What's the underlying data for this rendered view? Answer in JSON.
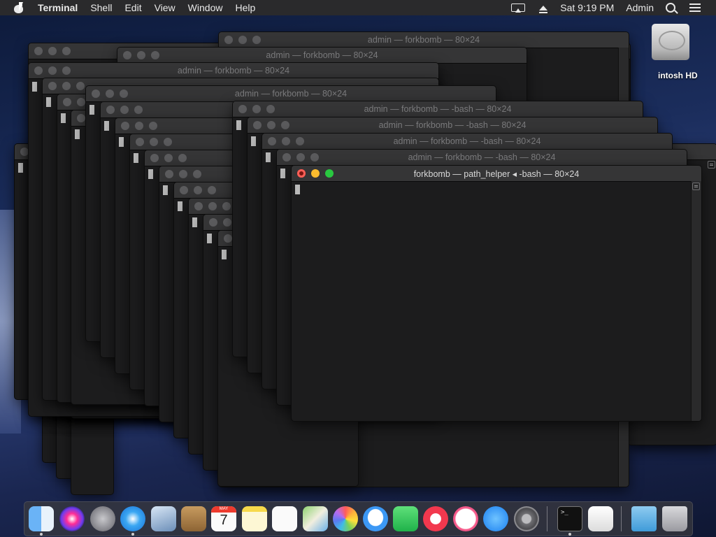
{
  "menubar": {
    "app_name": "Terminal",
    "items": [
      "Shell",
      "Edit",
      "View",
      "Window",
      "Help"
    ],
    "clock": "Sat 9:19 PM",
    "user": "Admin"
  },
  "desktop": {
    "disk_label": "intosh HD"
  },
  "windows": [
    {
      "title": "admin — forkbomb — 80×24",
      "front": false
    },
    {
      "title": "admin — forkbomb — 80×24",
      "front": false
    },
    {
      "title": "admin — forkbomb — 80×24",
      "front": false
    },
    {
      "title": "admin — forkbomb — 80×24",
      "front": false
    },
    {
      "title": "admin — forkbomb — -bash — 80×24",
      "front": false
    },
    {
      "title": "admin — forkbomb — -bash — 80×24",
      "front": false
    },
    {
      "title": "admin — forkbomb — -bash — 80×24",
      "front": false
    },
    {
      "title": "admin — forkbomb — -bash — 80×24",
      "front": false
    },
    {
      "title": "forkbomb — path_helper ◂ -bash — 80×24",
      "front": true
    }
  ],
  "dock": {
    "apps": [
      "finder-icon",
      "siri-icon",
      "launchpad-icon",
      "safari-icon",
      "mail-icon",
      "contacts-icon",
      "calendar-icon",
      "notes-icon",
      "reminders-icon",
      "maps-icon",
      "photos-icon",
      "messages-icon",
      "facetime-icon",
      "news-icon",
      "music-icon",
      "app-store-icon",
      "system-preferences-icon",
      "terminal-icon",
      "textedit-icon",
      "downloads-folder-icon",
      "trash-icon"
    ],
    "calendar_month": "MAY",
    "calendar_day": "7"
  }
}
